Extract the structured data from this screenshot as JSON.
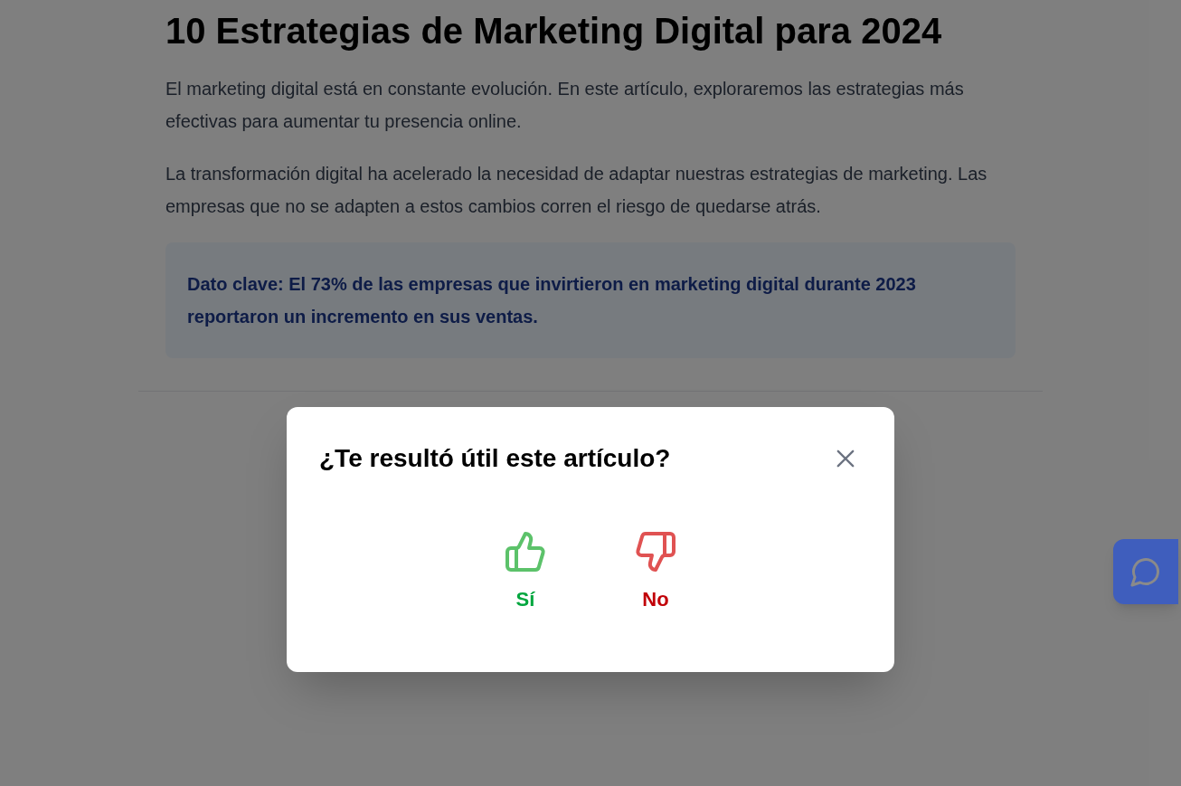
{
  "article": {
    "title": "10 Estrategias de Marketing Digital para 2024",
    "paragraphs": [
      "El marketing digital está en constante evolución. En este artículo, exploraremos las estrategias más efectivas para aumentar tu presencia online.",
      "La transformación digital ha acelerado la necesidad de adaptar nuestras estrategias de marketing. Las empresas que no se adapten a estos cambios corren el riesgo de quedarse atrás."
    ],
    "callout": "Dato clave: El 73% de las empresas que invirtieron en marketing digital durante 2023 reportaron un incremento en sus ventas."
  },
  "feedback_dialog": {
    "title": "¿Te resultó útil este artículo?",
    "options": [
      {
        "kind": "yes",
        "label": "Sí"
      },
      {
        "kind": "no",
        "label": "No"
      }
    ]
  }
}
